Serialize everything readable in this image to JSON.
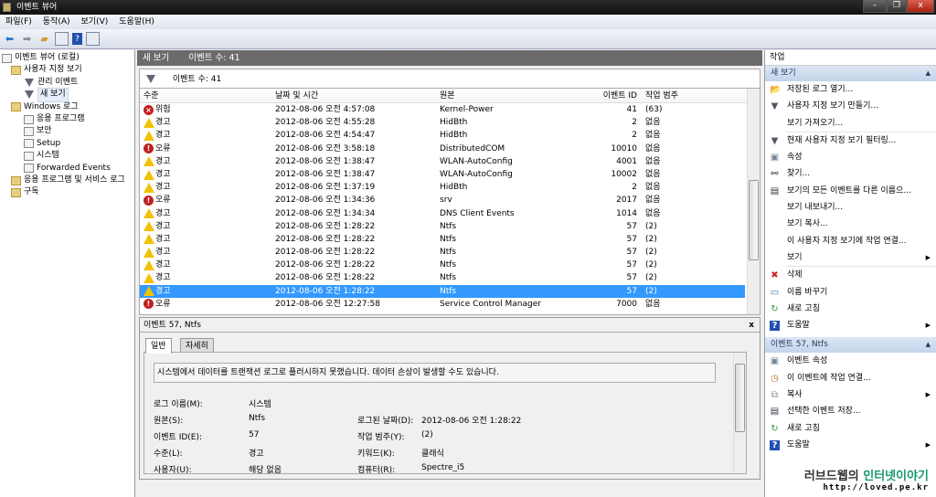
{
  "window": {
    "title": "이벤트 뷰어",
    "minimize": "–",
    "restore": "❐",
    "close": "x"
  },
  "menu": [
    "파일(F)",
    "동작(A)",
    "보기(V)",
    "도움말(H)"
  ],
  "tree": [
    {
      "label": "이벤트 뷰어 (로컬)",
      "level": 0,
      "icon": "event-viewer-icon"
    },
    {
      "label": "사용자 지정 보기",
      "level": 1,
      "icon": "folder-icon"
    },
    {
      "label": "관리 이벤트",
      "level": 2,
      "icon": "filter-icon"
    },
    {
      "label": "새 보기",
      "level": 2,
      "icon": "filter-icon",
      "selected": true
    },
    {
      "label": "Windows 로그",
      "level": 1,
      "icon": "folder-icon"
    },
    {
      "label": "응용 프로그램",
      "level": 2,
      "icon": "log-icon"
    },
    {
      "label": "보안",
      "level": 2,
      "icon": "log-icon"
    },
    {
      "label": "Setup",
      "level": 2,
      "icon": "log-icon"
    },
    {
      "label": "시스템",
      "level": 2,
      "icon": "log-icon"
    },
    {
      "label": "Forwarded Events",
      "level": 2,
      "icon": "log-icon"
    },
    {
      "label": "응용 프로그램 및 서비스 로그",
      "level": 1,
      "icon": "folder-icon"
    },
    {
      "label": "구독",
      "level": 1,
      "icon": "folder-icon"
    }
  ],
  "center": {
    "view_name": "새 보기",
    "event_count": "이벤트 수: 41",
    "filter_count": "이벤트 수: 41"
  },
  "columns": [
    "수준",
    "날짜 및 시간",
    "원본",
    "이벤트 ID",
    "작업 범주"
  ],
  "events": [
    {
      "level": "위험",
      "type": "critical",
      "time": "2012-08-06 오전 4:57:08",
      "source": "Kernel-Power",
      "id": "41",
      "category": "(63)"
    },
    {
      "level": "경고",
      "type": "warning",
      "time": "2012-08-06 오전 4:55:28",
      "source": "HidBth",
      "id": "2",
      "category": "없음"
    },
    {
      "level": "경고",
      "type": "warning",
      "time": "2012-08-06 오전 4:54:47",
      "source": "HidBth",
      "id": "2",
      "category": "없음"
    },
    {
      "level": "오류",
      "type": "error",
      "time": "2012-08-06 오전 3:58:18",
      "source": "DistributedCOM",
      "id": "10010",
      "category": "없음"
    },
    {
      "level": "경고",
      "type": "warning",
      "time": "2012-08-06 오전 1:38:47",
      "source": "WLAN-AutoConfig",
      "id": "4001",
      "category": "없음"
    },
    {
      "level": "경고",
      "type": "warning",
      "time": "2012-08-06 오전 1:38:47",
      "source": "WLAN-AutoConfig",
      "id": "10002",
      "category": "없음"
    },
    {
      "level": "경고",
      "type": "warning",
      "time": "2012-08-06 오전 1:37:19",
      "source": "HidBth",
      "id": "2",
      "category": "없음"
    },
    {
      "level": "오류",
      "type": "error",
      "time": "2012-08-06 오전 1:34:36",
      "source": "srv",
      "id": "2017",
      "category": "없음"
    },
    {
      "level": "경고",
      "type": "warning",
      "time": "2012-08-06 오전 1:34:34",
      "source": "DNS Client Events",
      "id": "1014",
      "category": "없음"
    },
    {
      "level": "경고",
      "type": "warning",
      "time": "2012-08-06 오전 1:28:22",
      "source": "Ntfs",
      "id": "57",
      "category": "(2)"
    },
    {
      "level": "경고",
      "type": "warning",
      "time": "2012-08-06 오전 1:28:22",
      "source": "Ntfs",
      "id": "57",
      "category": "(2)"
    },
    {
      "level": "경고",
      "type": "warning",
      "time": "2012-08-06 오전 1:28:22",
      "source": "Ntfs",
      "id": "57",
      "category": "(2)"
    },
    {
      "level": "경고",
      "type": "warning",
      "time": "2012-08-06 오전 1:28:22",
      "source": "Ntfs",
      "id": "57",
      "category": "(2)"
    },
    {
      "level": "경고",
      "type": "warning",
      "time": "2012-08-06 오전 1:28:22",
      "source": "Ntfs",
      "id": "57",
      "category": "(2)"
    },
    {
      "level": "경고",
      "type": "warning",
      "time": "2012-08-06 오전 1:28:22",
      "source": "Ntfs",
      "id": "57",
      "category": "(2)",
      "selected": true
    },
    {
      "level": "오류",
      "type": "error",
      "time": "2012-08-06 오전 12:27:58",
      "source": "Service Control Manager",
      "id": "7000",
      "category": "없음"
    }
  ],
  "detail": {
    "title": "이벤트 57, Ntfs",
    "close": "x",
    "tabs": [
      "일반",
      "자세히"
    ],
    "message": "시스템에서 데이터를 트랜잭션 로그로 플러시하지 못했습니다. 데이터 손상이 발생할 수도 있습니다.",
    "fields": {
      "log_name_label": "로그 이름(M):",
      "log_name": "시스템",
      "source_label": "원본(S):",
      "source": "Ntfs",
      "logged_label": "로그된 날짜(D):",
      "logged": "2012-08-06 오전 1:28:22",
      "event_id_label": "이벤트 ID(E):",
      "event_id": "57",
      "category_label": "작업 범주(Y):",
      "category": "(2)",
      "level_label": "수준(L):",
      "level": "경고",
      "keywords_label": "키워드(K):",
      "keywords": "클래식",
      "user_label": "사용자(U):",
      "user": "해당 없음",
      "computer_label": "컴퓨터(R):",
      "computer": "Spectre_i5"
    }
  },
  "actions": {
    "title": "작업",
    "section1": "새 보기",
    "items1": [
      {
        "label": "저장된 로그 열기...",
        "icon": "open-folder-icon"
      },
      {
        "label": "사용자 지정 보기 만들기...",
        "icon": "filter-icon"
      },
      {
        "label": "보기 가져오기...",
        "icon": ""
      },
      {
        "label": "현재 사용자 지정 보기 필터링...",
        "icon": "filter-icon",
        "sep": true
      },
      {
        "label": "속성",
        "icon": "properties-icon"
      },
      {
        "label": "찾기...",
        "icon": "binoculars-icon"
      },
      {
        "label": "보기의 모든 이벤트를 다른 이름으...",
        "icon": "save-icon"
      },
      {
        "label": "보기 내보내기...",
        "icon": ""
      },
      {
        "label": "보기 복사...",
        "icon": ""
      },
      {
        "label": "이 사용자 지정 보기에 작업 연결...",
        "icon": ""
      },
      {
        "label": "보기",
        "icon": "",
        "submenu": true
      },
      {
        "label": "삭제",
        "icon": "delete-icon",
        "sep": true
      },
      {
        "label": "이름 바꾸기",
        "icon": "rename-icon"
      },
      {
        "label": "새로 고침",
        "icon": "refresh-icon"
      },
      {
        "label": "도움말",
        "icon": "help-icon",
        "submenu": true
      }
    ],
    "section2": "이벤트 57, Ntfs",
    "items2": [
      {
        "label": "이벤트 속성",
        "icon": "properties-icon"
      },
      {
        "label": "이 이벤트에 작업 연결...",
        "icon": "task-icon"
      },
      {
        "label": "복사",
        "icon": "copy-icon",
        "submenu": true
      },
      {
        "label": "선택한 이벤트 저장...",
        "icon": "save-icon"
      },
      {
        "label": "새로 고침",
        "icon": "refresh-icon"
      },
      {
        "label": "도움말",
        "icon": "help-icon",
        "submenu": true
      }
    ]
  },
  "watermark": {
    "line1a": "러브드웹의",
    "line1b": "인터넷이야기",
    "line2": "http://loved.pe.kr"
  }
}
